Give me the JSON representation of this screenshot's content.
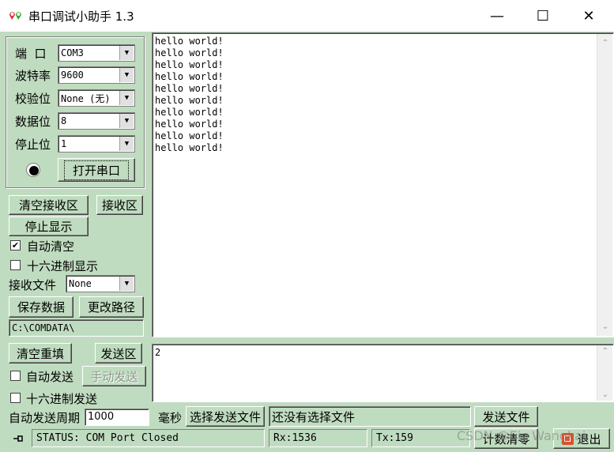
{
  "window": {
    "title": "串口调试小助手 1.3",
    "minimize": "—",
    "maximize": "☐",
    "close": "✕"
  },
  "serial": {
    "port_label": "端  口",
    "port_value": "COM3",
    "baud_label": "波特率",
    "baud_value": "9600",
    "parity_label": "校验位",
    "parity_value": "None (无)",
    "databits_label": "数据位",
    "databits_value": "8",
    "stopbits_label": "停止位",
    "stopbits_value": "1",
    "open_button": "打开串口"
  },
  "receive": {
    "clear_button": "清空接收区",
    "area_button": "接收区",
    "stop_display_button": "停止显示",
    "auto_clear_label": "自动清空",
    "auto_clear_checked": true,
    "hex_display_label": "十六进制显示",
    "hex_display_checked": false,
    "file_label": "接收文件",
    "file_value": "None",
    "save_button": "保存数据",
    "change_path_button": "更改路径",
    "path_value": "C:\\COMDATA\\",
    "lines": [
      "hello world!",
      "hello world!",
      "hello world!",
      "hello world!",
      "hello world!",
      "hello world!",
      "hello world!",
      "hello world!",
      "hello world!",
      "hello world!"
    ]
  },
  "send": {
    "clear_button": "清空重填",
    "area_button": "发送区",
    "auto_send_label": "自动发送",
    "manual_send_button": "手动发送",
    "hex_send_label": "十六进制发送",
    "period_label": "自动发送周期",
    "period_value": "1000",
    "unit_label": "毫秒",
    "choose_file_button": "选择发送文件",
    "file_status": "还没有选择文件",
    "send_file_button": "发送文件",
    "count_clear_button": "计数清零",
    "exit_button": "退出",
    "content": "2"
  },
  "status": {
    "text": "STATUS: COM Port Closed",
    "rx": "Rx:1536",
    "tx": "Tx:159"
  },
  "watermark": "CSDN @Eic Wangkai"
}
